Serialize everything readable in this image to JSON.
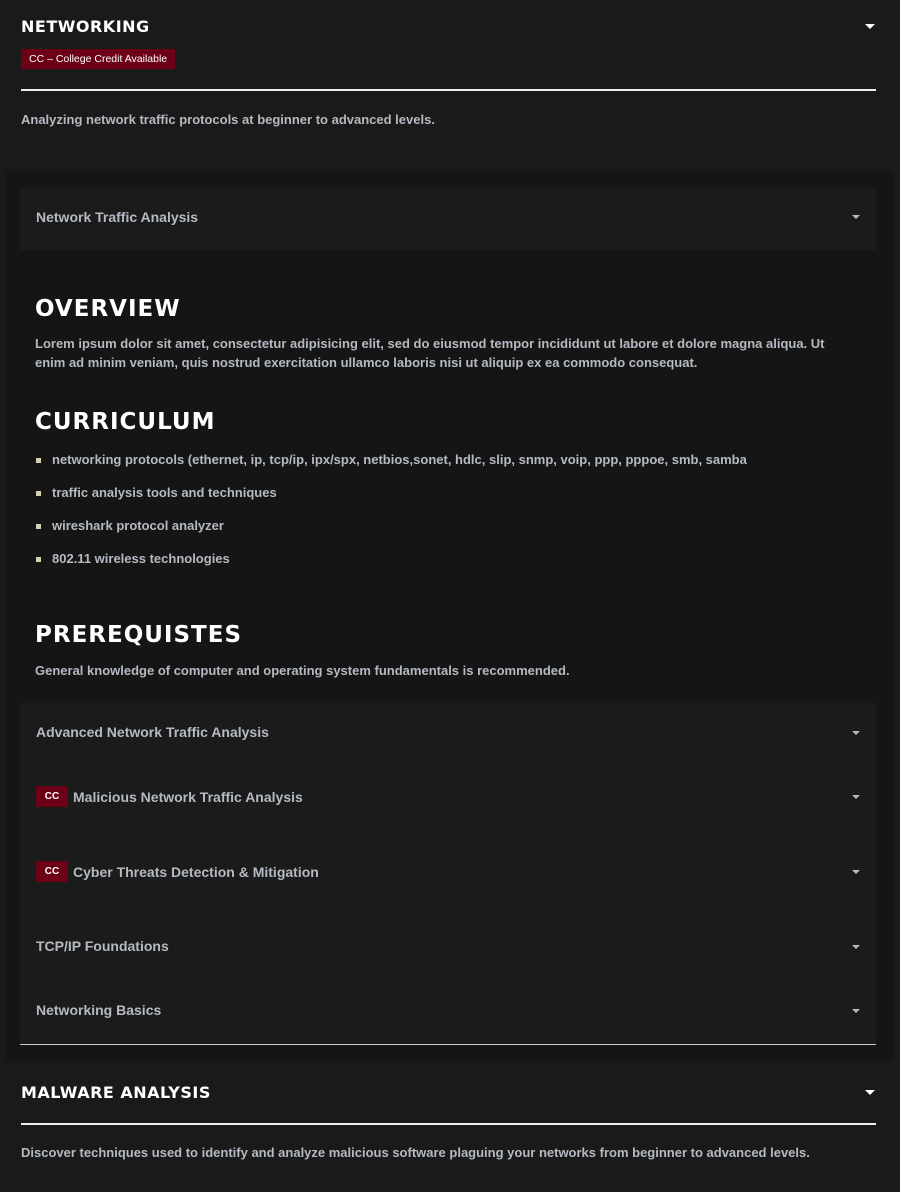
{
  "networking": {
    "title": "NETWORKING",
    "badge": "CC – College Credit Available",
    "description": "Analyzing network traffic protocols at beginner to advanced levels."
  },
  "course": {
    "title": "Network Traffic Analysis",
    "overview_heading": "OVERVIEW",
    "overview_text": "Lorem ipsum dolor sit amet, consectetur adipisicing elit, sed do eiusmod tempor incididunt ut labore et dolore magna aliqua. Ut enim ad minim veniam, quis nostrud exercitation ullamco laboris nisi ut aliquip ex ea commodo consequat.",
    "curriculum_heading": "CURRICULUM",
    "curriculum": [
      "networking protocols (ethernet, ip, tcp/ip, ipx/spx, netbios,sonet, hdlc, slip, snmp, voip, ppp, pppoe, smb, samba",
      "traffic analysis tools and techniques",
      "wireshark protocol analyzer",
      "802.11 wireless technologies"
    ],
    "prereq_heading": "PREREQUISTES",
    "prereq_text": "General knowledge of computer and operating system fundamentals is recommended."
  },
  "other_courses": [
    {
      "label": "Advanced Network Traffic Analysis",
      "cc": ""
    },
    {
      "label": "Malicious Network Traffic Analysis",
      "cc": "CC"
    },
    {
      "label": "Cyber Threats Detection & Mitigation",
      "cc": "CC"
    },
    {
      "label": "TCP/IP Foundations",
      "cc": ""
    },
    {
      "label": "Networking Basics",
      "cc": ""
    }
  ],
  "malware": {
    "title": "MALWARE ANALYSIS",
    "description": "Discover techniques used to identify and analyze malicious software plaguing your networks from beginner to advanced levels."
  }
}
